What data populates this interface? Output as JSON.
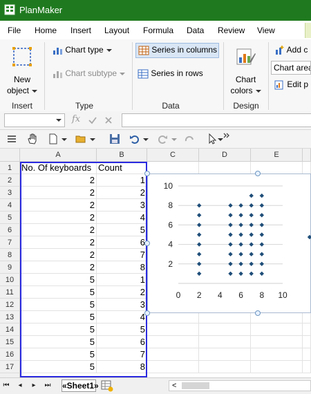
{
  "app": {
    "title": "PlanMaker"
  },
  "menu": [
    "File",
    "Home",
    "Insert",
    "Layout",
    "Formula",
    "Data",
    "Review",
    "View"
  ],
  "ribbon": {
    "insert_group": {
      "new_object_line1": "New",
      "new_object_line2": "object",
      "label": "Insert"
    },
    "type_group": {
      "chart_type": "Chart type",
      "chart_subtype": "Chart subtype",
      "label": "Type"
    },
    "data_group": {
      "series_columns": "Series in columns",
      "series_rows": "Series in rows",
      "label": "Data"
    },
    "design_group": {
      "chart_colors_line1": "Chart",
      "chart_colors_line2": "colors",
      "label": "Design"
    },
    "extra": {
      "add": "Add c",
      "chart_area": "Chart area",
      "edit": "Edit p"
    }
  },
  "formula_bar": {
    "fx": "fx"
  },
  "sheet": {
    "columns": [
      "A",
      "B",
      "C",
      "D",
      "E"
    ],
    "rows": [
      {
        "n": "1",
        "a": "No. Of keyboards",
        "b": "Count"
      },
      {
        "n": "2",
        "a": "2",
        "b": "1"
      },
      {
        "n": "3",
        "a": "2",
        "b": "2"
      },
      {
        "n": "4",
        "a": "2",
        "b": "3"
      },
      {
        "n": "5",
        "a": "2",
        "b": "4"
      },
      {
        "n": "6",
        "a": "2",
        "b": "5"
      },
      {
        "n": "7",
        "a": "2",
        "b": "6"
      },
      {
        "n": "8",
        "a": "2",
        "b": "7"
      },
      {
        "n": "9",
        "a": "2",
        "b": "8"
      },
      {
        "n": "10",
        "a": "5",
        "b": "1"
      },
      {
        "n": "11",
        "a": "5",
        "b": "2"
      },
      {
        "n": "12",
        "a": "5",
        "b": "3"
      },
      {
        "n": "13",
        "a": "5",
        "b": "4"
      },
      {
        "n": "14",
        "a": "5",
        "b": "5"
      },
      {
        "n": "15",
        "a": "5",
        "b": "6"
      },
      {
        "n": "16",
        "a": "5",
        "b": "7"
      },
      {
        "n": "17",
        "a": "5",
        "b": "8"
      }
    ]
  },
  "chart_data": {
    "type": "scatter",
    "xlim": [
      0,
      10
    ],
    "ylim": [
      0,
      10
    ],
    "x_ticks": [
      "0",
      "2",
      "4",
      "6",
      "8",
      "10"
    ],
    "y_ticks": [
      "2",
      "4",
      "6",
      "8",
      "10"
    ],
    "grid": "horizontal",
    "marker_color": "#1f4e79",
    "series": [
      {
        "x": [
          2,
          2,
          2,
          2,
          2,
          2,
          2,
          2,
          5,
          5,
          5,
          5,
          5,
          5,
          5,
          5,
          6,
          6,
          6,
          6,
          6,
          6,
          6,
          6,
          7,
          7,
          7,
          7,
          7,
          7,
          7,
          7,
          7,
          8,
          8,
          8,
          8,
          8,
          8,
          8,
          8,
          8
        ],
        "y": [
          1,
          2,
          3,
          4,
          5,
          6,
          7,
          8,
          1,
          2,
          3,
          4,
          5,
          6,
          7,
          8,
          1,
          2,
          3,
          4,
          5,
          6,
          7,
          8,
          1,
          2,
          3,
          4,
          5,
          6,
          7,
          8,
          9,
          1,
          2,
          3,
          4,
          5,
          6,
          7,
          8,
          9
        ]
      }
    ]
  },
  "sheet_tabs": {
    "active": "«Sheet1»"
  }
}
